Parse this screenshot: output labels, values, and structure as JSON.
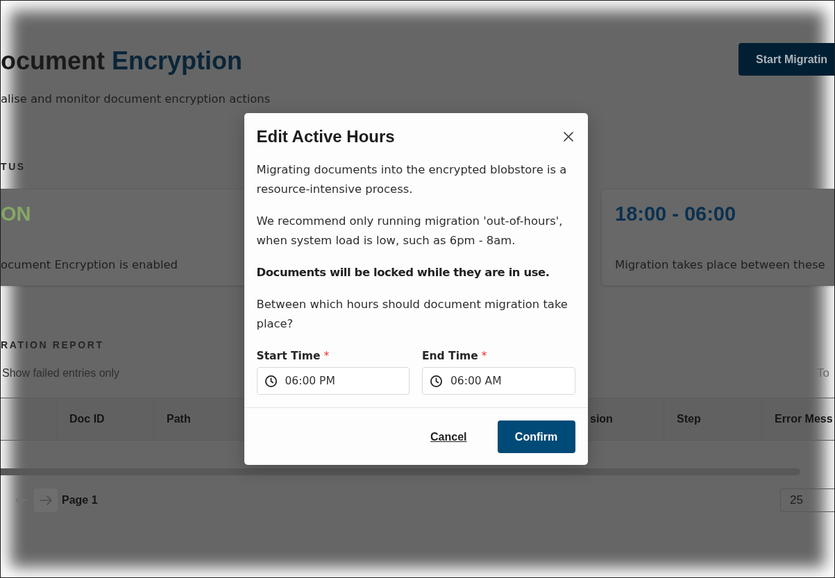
{
  "page": {
    "header": {
      "title_lead": "ocument",
      "title_accent": "Encryption",
      "subtitle": "alise and monitor document encryption actions",
      "action_button": "Start Migratin"
    },
    "status_section": {
      "label": "TUS",
      "cards": [
        {
          "kind": "status",
          "value": "ON",
          "enabled": true,
          "caption": "ocument Encryption is enabled"
        },
        {
          "kind": "hours",
          "value": "18:00 - 06:00",
          "caption": "Migration takes place between these"
        }
      ]
    },
    "report_section": {
      "label": "RATION REPORT",
      "filter_label": "Show failed entries only",
      "total_label": "To",
      "table": {
        "columns": [
          "Doc ID",
          "Path",
          "sion",
          "Step",
          "Error Mess"
        ]
      },
      "pagination": {
        "previous": {
          "disabled": true
        },
        "next": {
          "disabled": false
        },
        "page_label": "Page 1",
        "page_size": "25"
      }
    }
  },
  "dialog": {
    "title": "Edit Active Hours",
    "paragraphs": [
      {
        "text": "Migrating documents into the encrypted blobstore is a resource-intensive process.",
        "bold": false
      },
      {
        "text": "We recommend only running migration 'out-of-hours', when system load is low, such as 6pm - 8am.",
        "bold": false
      },
      {
        "text": "Documents will be locked while they are in use.",
        "bold": true
      },
      {
        "text": "Between which hours should document migration take place?",
        "bold": false
      }
    ],
    "fields": [
      {
        "label": "Start Time",
        "required_mark": "*",
        "value": "06:00 PM"
      },
      {
        "label": "End Time",
        "required_mark": "*",
        "value": "06:00 AM"
      }
    ],
    "buttons": [
      {
        "kind": "link",
        "label": "Cancel"
      },
      {
        "kind": "primary",
        "label": "Confirm"
      }
    ]
  }
}
